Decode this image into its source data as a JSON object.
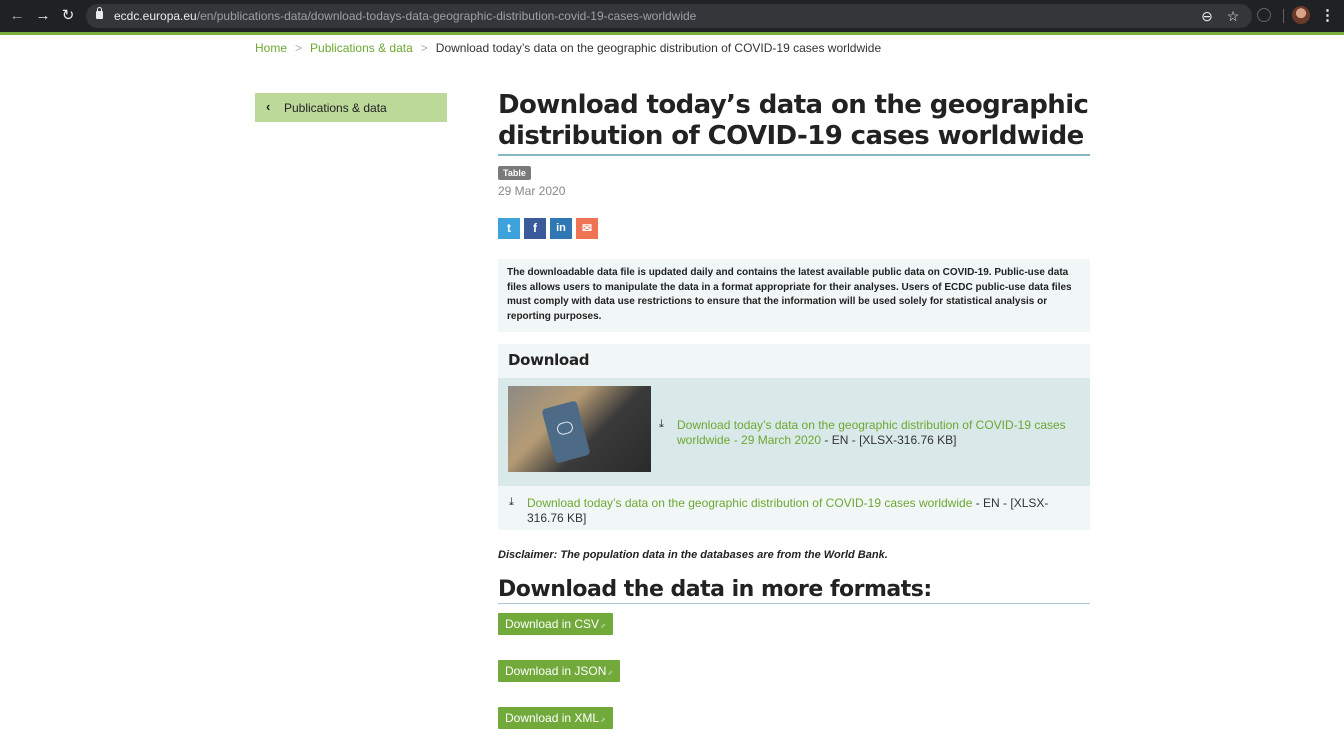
{
  "browser": {
    "url_host": "ecdc.europa.eu",
    "url_path": "/en/publications-data/download-todays-data-geographic-distribution-covid-19-cases-worldwide",
    "icons": [
      "back-icon",
      "forward-icon",
      "reload-icon",
      "lock-icon",
      "zoom-out-icon",
      "star-icon",
      "extension-icon",
      "profile-avatar",
      "menu-icon"
    ]
  },
  "breadcrumb": {
    "items": [
      "Home",
      "Publications & data"
    ],
    "separator": ">",
    "current": "Download today’s data on the geographic distribution of COVID-19 cases worldwide"
  },
  "sidebar": {
    "back_label": "Publications & data"
  },
  "page": {
    "title": "Download today’s data on the geographic distribution of COVID-19 cases worldwide",
    "badge": "Table",
    "date": "29 Mar 2020",
    "share": [
      {
        "name": "twitter",
        "glyph": "t",
        "color": "#3ea3dc"
      },
      {
        "name": "facebook",
        "glyph": "f",
        "color": "#3b5a99"
      },
      {
        "name": "linkedin",
        "glyph": "in",
        "color": "#2f78b3"
      },
      {
        "name": "email",
        "glyph": "✉",
        "color": "#ee7454"
      }
    ],
    "intro": "The downloadable data file is updated daily and contains the latest available public data on COVID-19. Public-use data files allows users to manipulate the data in a format appropriate for their analyses. Users of ECDC public-use data files must comply with data use restrictions to ensure that the information will be used solely for statistical analysis or reporting purposes.",
    "download": {
      "heading": "Download",
      "featured_link": "Download today’s data on the geographic distribution of COVID-19 cases worldwide - 29 March 2020",
      "featured_meta": " - EN - [XLSX-316.76 KB]",
      "plain_link": "Download today’s data on the geographic distribution of COVID-19 cases worldwide",
      "plain_meta": " - EN - [XLSX-316.76 KB]"
    },
    "disclaimer": "Disclaimer: The population data in the databases are from the World Bank.",
    "formats_heading": "Download the data in more formats:",
    "format_buttons": [
      "Download in CSV",
      "Download in JSON",
      "Download in XML"
    ]
  },
  "colors": {
    "accent_green": "#71a93a",
    "link_green": "#6da832",
    "sidebar_green": "#bcd99a",
    "title_rule": "#87b9c5"
  }
}
